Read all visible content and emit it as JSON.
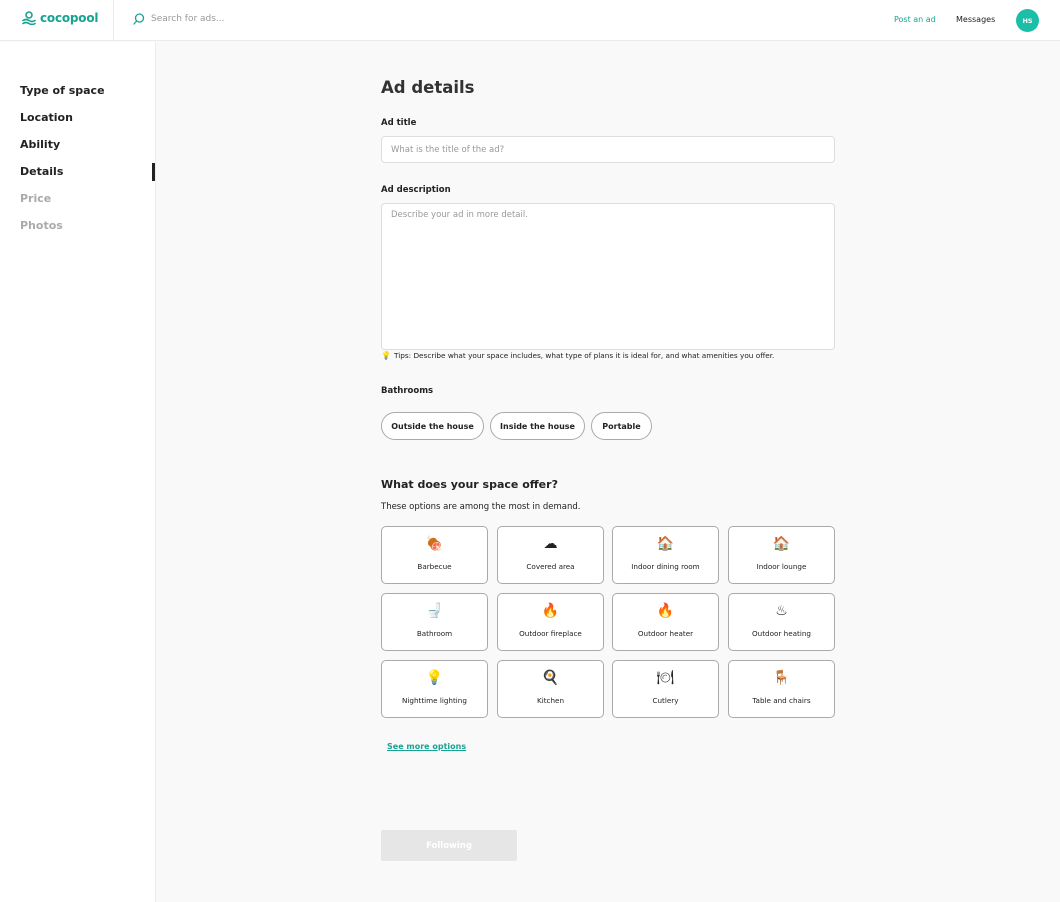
{
  "header": {
    "brand": "cocopool",
    "search_placeholder": "Search for ads...",
    "post_ad": "Post an ad",
    "messages": "Messages",
    "avatar_initials": "HS",
    "accent_color": "#17a392"
  },
  "sidebar": {
    "items": [
      {
        "label": "Type of space",
        "state": "done"
      },
      {
        "label": "Location",
        "state": "done"
      },
      {
        "label": "Ability",
        "state": "done"
      },
      {
        "label": "Details",
        "state": "active"
      },
      {
        "label": "Price",
        "state": "disabled"
      },
      {
        "label": "Photos",
        "state": "disabled"
      }
    ]
  },
  "main": {
    "title": "Ad details",
    "ad_title_label": "Ad title",
    "ad_title_placeholder": "What is the title of the ad?",
    "ad_title_value": "",
    "ad_description_label": "Ad description",
    "ad_description_placeholder": "Describe your ad in more detail.",
    "ad_description_value": "",
    "tips_icon": "lightbulb-icon",
    "tips": "Tips: Describe what your space includes, what type of plans it is ideal for, and what amenities you offer.",
    "bathrooms_label": "Bathrooms",
    "bathroom_options": [
      "Outside the house",
      "Inside the house",
      "Portable"
    ],
    "offer_title": "What does your space offer?",
    "offer_subtitle": "These options are among the most in demand.",
    "amenities": [
      {
        "label": "Barbecue",
        "emoji": "🍖"
      },
      {
        "label": "Covered area",
        "emoji": "☁"
      },
      {
        "label": "Indoor dining room",
        "emoji": "🏠"
      },
      {
        "label": "Indoor lounge",
        "emoji": "🏠"
      },
      {
        "label": "Bathroom",
        "emoji": "🚽"
      },
      {
        "label": "Outdoor fireplace",
        "emoji": "🔥"
      },
      {
        "label": "Outdoor heater",
        "emoji": "🔥"
      },
      {
        "label": "Outdoor heating",
        "emoji": "♨"
      },
      {
        "label": "Nighttime lighting",
        "emoji": "💡"
      },
      {
        "label": "Kitchen",
        "emoji": "🍳"
      },
      {
        "label": "Cutlery",
        "emoji": "🍽"
      },
      {
        "label": "Table and chairs",
        "emoji": "🪑"
      }
    ],
    "see_more": "See more options",
    "next_button": "Following"
  }
}
